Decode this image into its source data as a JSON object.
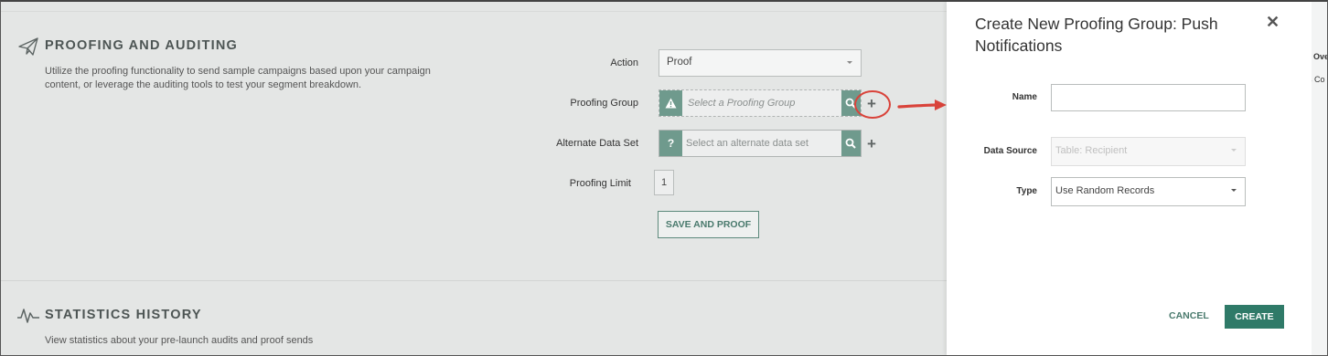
{
  "proofing": {
    "title": "PROOFING AND AUDITING",
    "description": "Utilize the proofing functionality to send sample campaigns based upon your campaign content, or leverage the auditing tools to test your segment breakdown.",
    "action_label": "Action",
    "action_value": "Proof",
    "group_label": "Proofing Group",
    "group_placeholder": "Select a Proofing Group",
    "group_addon": "!",
    "alt_label": "Alternate Data Set",
    "alt_placeholder": "Select an alternate data set",
    "alt_addon": "?",
    "limit_label": "Proofing Limit",
    "limit_value": "1",
    "save_label": "SAVE AND PROOF"
  },
  "statistics": {
    "title": "STATISTICS HISTORY",
    "description": "View statistics about your pre-launch audits and proof sends"
  },
  "modal": {
    "title": "Create New Proofing Group: Push Notifications",
    "name_label": "Name",
    "name_value": "",
    "source_label": "Data Source",
    "source_value": "Table: Recipient",
    "type_label": "Type",
    "type_value": "Use Random Records",
    "cancel_label": "CANCEL",
    "create_label": "CREATE"
  },
  "background_strip": {
    "text1": "Ove",
    "text2": "s Co"
  },
  "colors": {
    "accent": "#2f7a68",
    "addon": "#6f9a8d",
    "highlight": "#d9433a"
  }
}
